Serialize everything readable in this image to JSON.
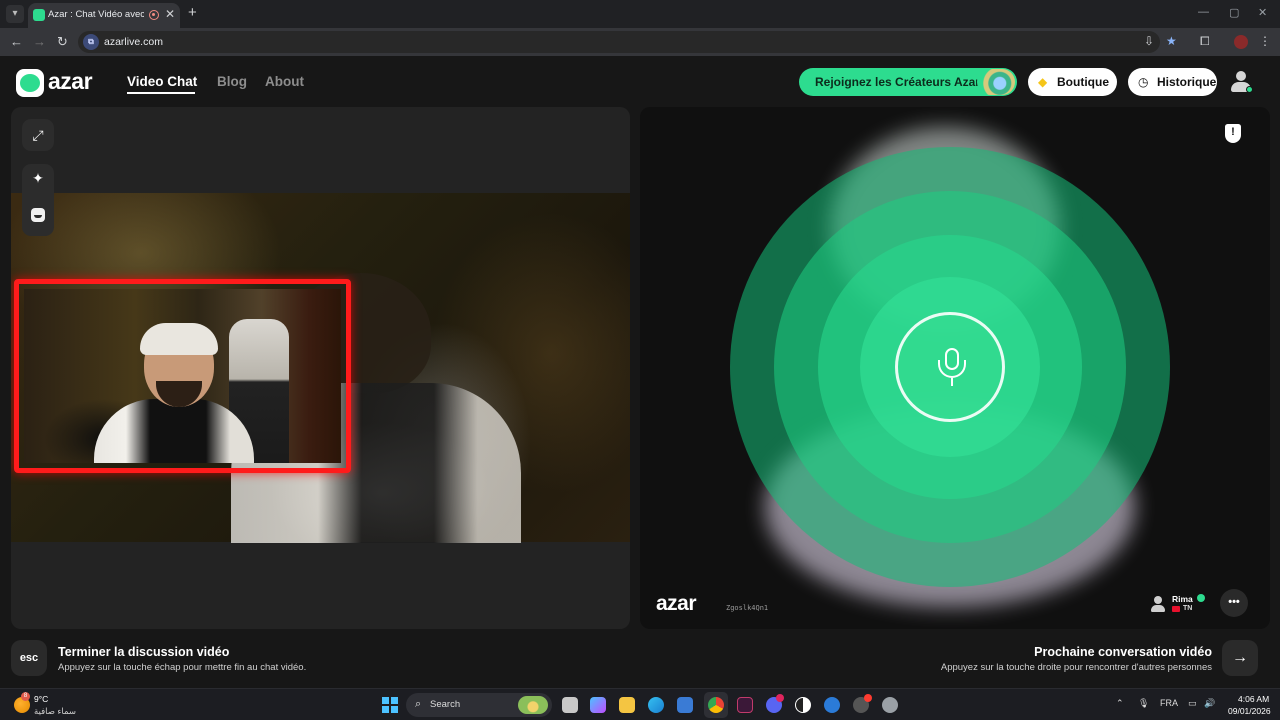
{
  "browser": {
    "tab_title": "Azar : Chat Vidéo avec de n",
    "close_glyph": "✕",
    "new_tab_glyph": "+",
    "url": "azarlive.com",
    "window_controls": [
      "—",
      "▢",
      "✕"
    ]
  },
  "header": {
    "logo_text": "azar",
    "nav": [
      {
        "label": "Video Chat",
        "active": true
      },
      {
        "label": "Blog",
        "active": false
      },
      {
        "label": "About",
        "active": false
      }
    ],
    "creators_label": "Rejoignez les Créateurs Azar",
    "shop_label": "Boutique",
    "history_label": "Historique"
  },
  "right_panel": {
    "logo_text": "azar",
    "user_id": "Zgoslk4Qn1",
    "peer_name": "Rima",
    "peer_country": "TN",
    "accent": "#2ddc8f"
  },
  "bottom": {
    "esc_label": "esc",
    "end_title": "Terminer la discussion vidéo",
    "end_sub": "Appuyez sur la touche échap pour mettre fin au chat vidéo.",
    "next_title": "Prochaine conversation vidéo",
    "next_sub": "Appuyez sur la touche droite pour rencontrer d'autres personnes",
    "next_glyph": "→"
  },
  "taskbar": {
    "temperature": "9°C",
    "weather_desc": "سماء صافية",
    "weather_badge": "8",
    "search_label": "Search",
    "language": "FRA",
    "time": "4:06 AM",
    "date": "09/01/2026"
  }
}
